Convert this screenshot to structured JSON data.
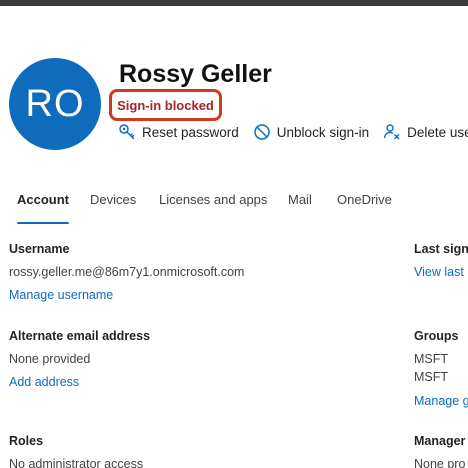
{
  "user": {
    "initials": "RO",
    "display_name": "Rossy Geller",
    "status_badge": "Sign-in blocked"
  },
  "actions": [
    {
      "label": "Reset password",
      "icon": "key-icon"
    },
    {
      "label": "Unblock sign-in",
      "icon": "blocked-circle-icon"
    },
    {
      "label": "Delete user",
      "icon": "delete-user-icon"
    }
  ],
  "tabs": [
    {
      "label": "Account",
      "selected": true
    },
    {
      "label": "Devices"
    },
    {
      "label": "Licenses and apps"
    },
    {
      "label": "Mail"
    },
    {
      "label": "OneDrive"
    }
  ],
  "account": {
    "username": {
      "label": "Username",
      "value": "rossy.geller.me@86m7y1.onmicrosoft.com",
      "link": "Manage username"
    },
    "alternate_email": {
      "label": "Alternate email address",
      "value": "None provided",
      "link": "Add address"
    },
    "roles": {
      "label": "Roles",
      "value": "No administrator access"
    },
    "last_signin": {
      "label": "Last sign-",
      "link": "View last"
    },
    "groups": {
      "label": "Groups",
      "items": [
        "MSFT",
        "MSFT"
      ],
      "link": "Manage g"
    },
    "manager": {
      "label": "Manager",
      "value": "None pro"
    }
  },
  "colors": {
    "accent": "#0f6cbd",
    "status_border": "#d13b1d",
    "status_text": "#a4262c"
  }
}
